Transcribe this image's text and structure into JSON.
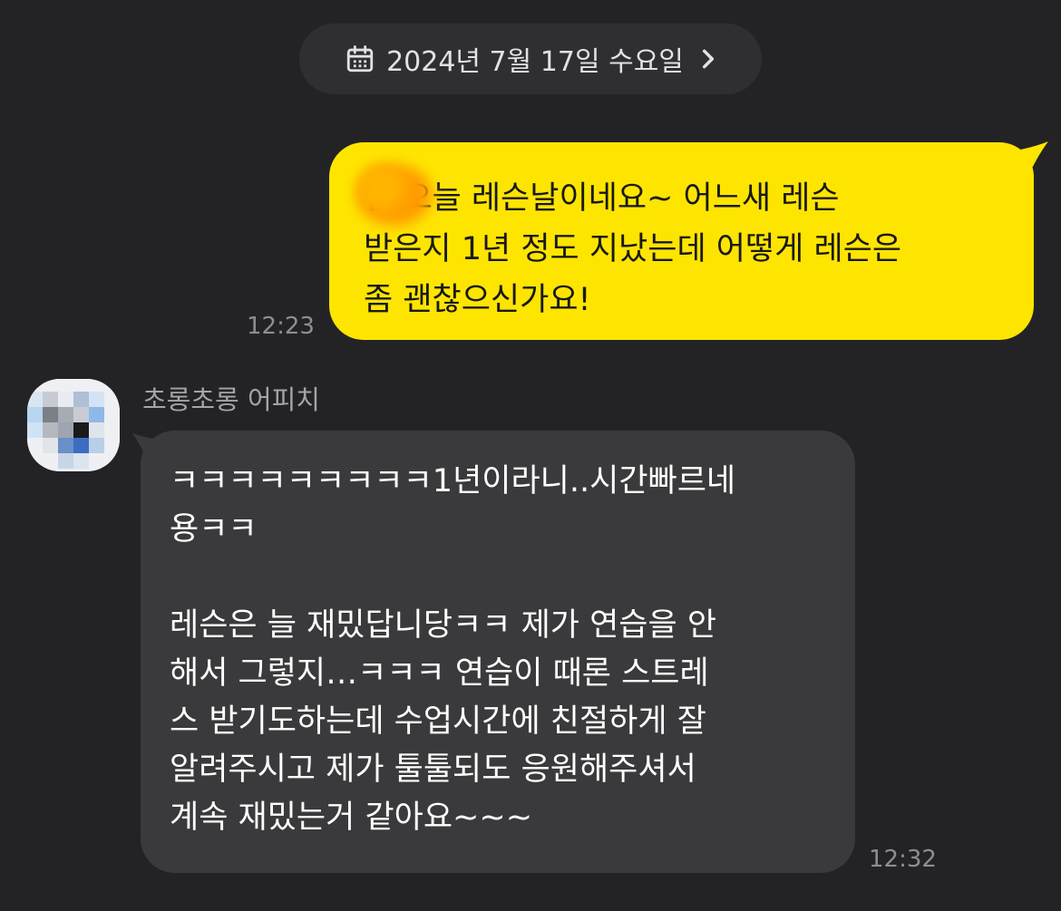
{
  "date_divider": {
    "label": "2024년 7월 17일 수요일",
    "icon": "calendar-icon",
    "chevron": "chevron-right-icon"
  },
  "messages": [
    {
      "direction": "outgoing",
      "text": "님 오늘 레슨날이네요~ 어느새 레슨\n받은지 1년 정도 지났는데 어떻게 레슨은\n좀 괜찮으신가요!",
      "time": "12:23",
      "bubble_color": "#FEE500",
      "redacted": true
    },
    {
      "direction": "incoming",
      "sender": "초롱초롱 어피치",
      "text": "ㅋㅋㅋㅋㅋㅋㅋㅋㅋ1년이라니..시간빠르네\n용ㅋㅋ\n\n레슨은 늘 재밌답니당ㅋㅋ 제가 연습을 안\n해서 그렇지…ㅋㅋㅋ 연습이 때론 스트레\n스 받기도하는데 수업시간에 친절하게 잘\n알려주시고 제가 툴툴되도 응원해주셔서\n계속 재밌는거 같아요~~~",
      "time": "12:32",
      "bubble_color": "#3A3A3C",
      "avatar": "pixelated-avatar"
    }
  ],
  "colors": {
    "background": "#232325",
    "date_pill": "#2F2F31",
    "timestamp": "#8E8E92",
    "sender_name": "#A4A4A8"
  }
}
